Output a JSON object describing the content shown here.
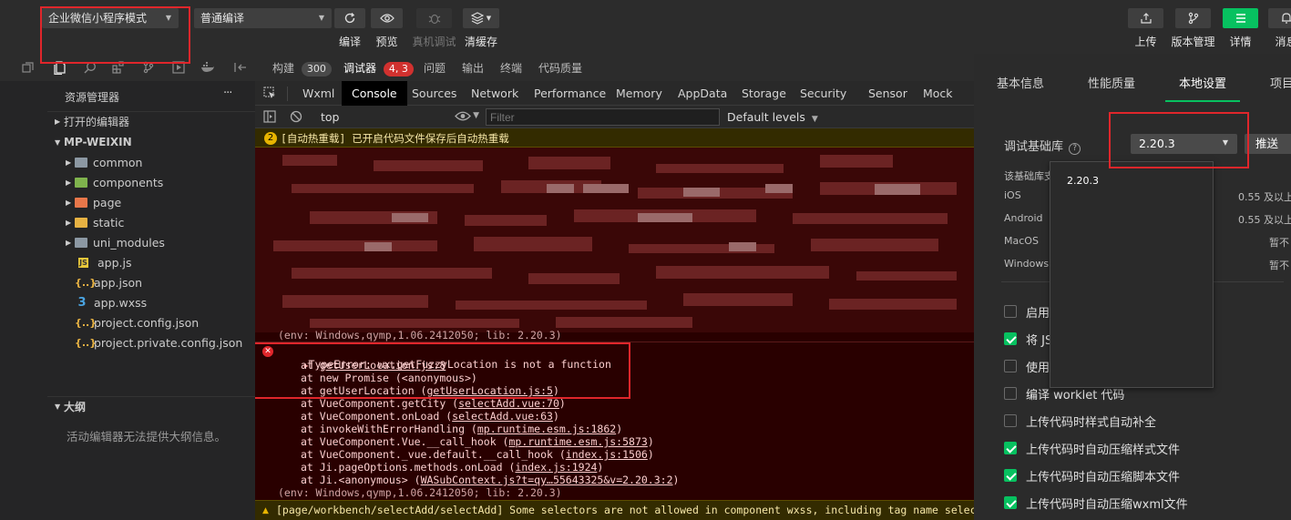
{
  "toolbar": {
    "mode_select": "企业微信小程序模式",
    "compile_select": "普通编译",
    "compile_label": "编译",
    "preview_label": "预览",
    "real_debug_label": "真机调试",
    "clear_cache_label": "清缓存",
    "upload_label": "上传",
    "version_label": "版本管理",
    "details_label": "详情",
    "messages_label": "消息"
  },
  "panel_tabs": {
    "build": "构建",
    "build_count": "300",
    "debugger": "调试器",
    "debugger_count": "4, 3",
    "issues": "问题",
    "output": "输出",
    "terminal": "终端",
    "code_quality": "代码质量"
  },
  "explorer": {
    "title": "资源管理器",
    "more": "···",
    "open_editors": "打开的编辑器",
    "project": "MP-WEIXIN",
    "items": [
      {
        "name": "common",
        "kind": "folder"
      },
      {
        "name": "components",
        "kind": "folder"
      },
      {
        "name": "page",
        "kind": "folder"
      },
      {
        "name": "static",
        "kind": "folder"
      },
      {
        "name": "uni_modules",
        "kind": "folder"
      },
      {
        "name": "app.js",
        "kind": "js"
      },
      {
        "name": "app.json",
        "kind": "json"
      },
      {
        "name": "app.wxss",
        "kind": "wxss"
      },
      {
        "name": "project.config.json",
        "kind": "json"
      },
      {
        "name": "project.private.config.json",
        "kind": "json"
      }
    ],
    "outline_title": "大纲",
    "outline_empty": "活动编辑器无法提供大纲信息。"
  },
  "devtools": {
    "tabs": [
      "Wxml",
      "Console",
      "Sources",
      "Network",
      "Performance",
      "Memory",
      "AppData",
      "Storage",
      "Security",
      "Sensor",
      "Mock"
    ],
    "context": "top",
    "filter_placeholder": "Filter",
    "levels": "Default levels"
  },
  "console": {
    "warning_count": "2",
    "warning_text": "[自动热重载] 已开启代码文件保存后自动热重载",
    "env_line_1": "(env: Windows,qymp,1.06.2412050; lib: 2.20.3)",
    "error_head": "TypeError: wx.getFuzzyLocation is not a function",
    "stack": [
      {
        "pre": "at ",
        "fn": "",
        "link": "getUserLocation.js:8",
        "post": ""
      },
      {
        "pre": "at new Promise (<anonymous>)",
        "fn": "",
        "link": "",
        "post": ""
      },
      {
        "pre": "at getUserLocation (",
        "fn": "",
        "link": "getUserLocation.js:5",
        "post": ")"
      },
      {
        "pre": "at VueComponent.getCity (",
        "fn": "",
        "link": "selectAdd.vue:70",
        "post": ")"
      },
      {
        "pre": "at VueComponent.onLoad (",
        "fn": "",
        "link": "selectAdd.vue:63",
        "post": ")"
      },
      {
        "pre": "at invokeWithErrorHandling (",
        "fn": "",
        "link": "mp.runtime.esm.js:1862",
        "post": ")"
      },
      {
        "pre": "at VueComponent.Vue.__call_hook (",
        "fn": "",
        "link": "mp.runtime.esm.js:5873",
        "post": ")"
      },
      {
        "pre": "at VueComponent._vue.default.__call_hook (",
        "fn": "",
        "link": "index.js:1506",
        "post": ")"
      },
      {
        "pre": "at Ji.pageOptions.methods.onLoad (",
        "fn": "",
        "link": "index.js:1924",
        "post": ")"
      },
      {
        "pre": "at Ji.<anonymous> (",
        "fn": "",
        "link": "WASubContext.js?t=qy…55643325&v=2.20.3:2",
        "post": ")"
      }
    ],
    "env_line_2": "(env: Windows,qymp,1.06.2412050; lib: 2.20.3)",
    "last_warning": "[page/workbench/selectAdd/selectAdd] Some selectors are not allowed in component wxss, including tag name selectors,"
  },
  "right_panel": {
    "tabs": [
      "基本信息",
      "性能质量",
      "本地设置",
      "项目"
    ],
    "active_tab": "本地设置",
    "lib_label": "调试基础库",
    "lib_value": "2.20.3",
    "push_label": "推送",
    "dropdown_option": "2.20.3",
    "support_label": "该基础库支",
    "platforms": [
      {
        "name": "iOS",
        "value": "0.55 及以上"
      },
      {
        "name": "Android",
        "value": "0.55 及以上"
      },
      {
        "name": "MacOS",
        "value": "暂不"
      },
      {
        "name": "Windows",
        "value": "暂不"
      }
    ],
    "checkboxes": [
      {
        "label": "启用",
        "checked": false
      },
      {
        "label": "将 JS",
        "checked": true
      },
      {
        "label": "使用",
        "checked": false
      },
      {
        "label": "编译 worklet 代码",
        "checked": false
      },
      {
        "label": "上传代码时样式自动补全",
        "checked": false
      },
      {
        "label": "上传代码时自动压缩样式文件",
        "checked": true
      },
      {
        "label": "上传代码时自动压缩脚本文件",
        "checked": true
      },
      {
        "label": "上传代码时自动压缩wxml文件",
        "checked": true
      }
    ]
  },
  "colors": {
    "accent_green": "#07c160",
    "error_red": "#e0262b",
    "console_bg": "#290000",
    "warning_bg": "#332b00"
  }
}
